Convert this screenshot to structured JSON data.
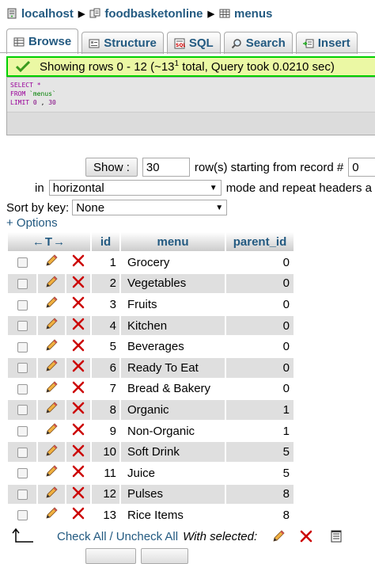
{
  "breadcrumb": {
    "server": "localhost",
    "database": "foodbasketonline",
    "table": "menus"
  },
  "tabs": [
    {
      "label": "Browse",
      "icon": "browse-icon",
      "active": true
    },
    {
      "label": "Structure",
      "icon": "structure-icon"
    },
    {
      "label": "SQL",
      "icon": "sql-icon"
    },
    {
      "label": "Search",
      "icon": "search-icon"
    },
    {
      "label": "Insert",
      "icon": "insert-icon"
    }
  ],
  "message": {
    "text_pre": "Showing rows 0 - 12 (~13",
    "sup": "1",
    "text_post": " total, Query took 0.0210 sec)"
  },
  "sql": {
    "select": "SELECT",
    "star": "*",
    "from": "FROM",
    "table": "`menus`",
    "limit": "LIMIT",
    "offset": "0",
    "comma": ",",
    "count": "30"
  },
  "controls": {
    "show_label": "Show :",
    "rows_value": "30",
    "rows_text": "row(s) starting from record #",
    "start_value": "0",
    "in_label": "in",
    "mode_value": "horizontal",
    "mode_text": "mode and repeat headers a",
    "sort_label": "Sort by key:",
    "sort_value": "None",
    "options_label": "+ Options"
  },
  "table": {
    "headers": {
      "arrows": "←T→",
      "id": "id",
      "menu": "menu",
      "parent_id": "parent_id"
    },
    "rows": [
      {
        "id": "1",
        "menu": "Grocery",
        "parent_id": "0"
      },
      {
        "id": "2",
        "menu": "Vegetables",
        "parent_id": "0"
      },
      {
        "id": "3",
        "menu": "Fruits",
        "parent_id": "0"
      },
      {
        "id": "4",
        "menu": "Kitchen",
        "parent_id": "0"
      },
      {
        "id": "5",
        "menu": "Beverages",
        "parent_id": "0"
      },
      {
        "id": "6",
        "menu": "Ready To Eat",
        "parent_id": "0"
      },
      {
        "id": "7",
        "menu": "Bread & Bakery",
        "parent_id": "0"
      },
      {
        "id": "8",
        "menu": "Organic",
        "parent_id": "1"
      },
      {
        "id": "9",
        "menu": "Non-Organic",
        "parent_id": "1"
      },
      {
        "id": "10",
        "menu": "Soft Drink",
        "parent_id": "5"
      },
      {
        "id": "11",
        "menu": "Juice",
        "parent_id": "5"
      },
      {
        "id": "12",
        "menu": "Pulses",
        "parent_id": "8"
      },
      {
        "id": "13",
        "menu": "Rice Items",
        "parent_id": "8"
      }
    ]
  },
  "bottom": {
    "check_all": "Check All",
    "separator": "/",
    "uncheck_all": "Uncheck All",
    "with_selected": "With selected:"
  },
  "colors": {
    "link": "#235a81",
    "success_border": "#00d000",
    "success_bg": "#ebf8a4",
    "delete_red": "#cc0000",
    "row_even": "#dfdfdf"
  }
}
